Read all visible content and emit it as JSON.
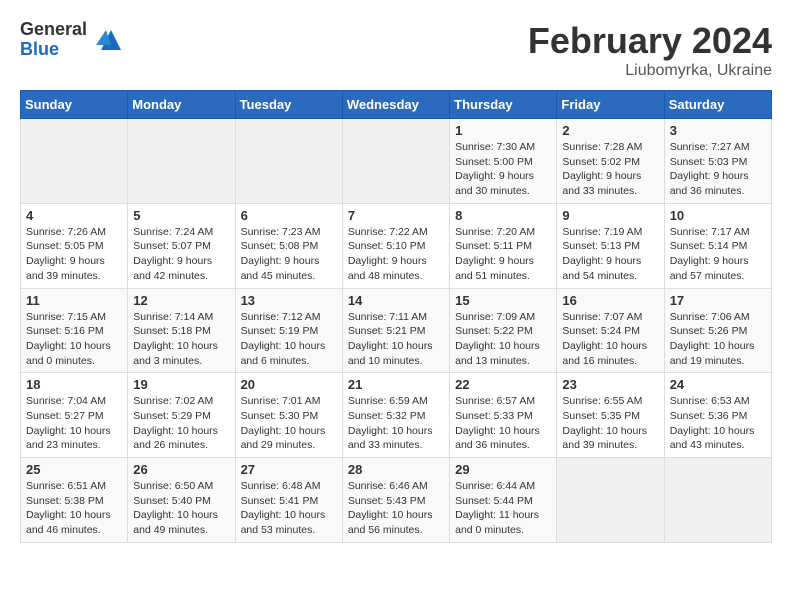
{
  "header": {
    "logo_general": "General",
    "logo_blue": "Blue",
    "month_title": "February 2024",
    "location": "Liubomyrka, Ukraine"
  },
  "weekdays": [
    "Sunday",
    "Monday",
    "Tuesday",
    "Wednesday",
    "Thursday",
    "Friday",
    "Saturday"
  ],
  "weeks": [
    [
      {
        "day": "",
        "info": ""
      },
      {
        "day": "",
        "info": ""
      },
      {
        "day": "",
        "info": ""
      },
      {
        "day": "",
        "info": ""
      },
      {
        "day": "1",
        "info": "Sunrise: 7:30 AM\nSunset: 5:00 PM\nDaylight: 9 hours\nand 30 minutes."
      },
      {
        "day": "2",
        "info": "Sunrise: 7:28 AM\nSunset: 5:02 PM\nDaylight: 9 hours\nand 33 minutes."
      },
      {
        "day": "3",
        "info": "Sunrise: 7:27 AM\nSunset: 5:03 PM\nDaylight: 9 hours\nand 36 minutes."
      }
    ],
    [
      {
        "day": "4",
        "info": "Sunrise: 7:26 AM\nSunset: 5:05 PM\nDaylight: 9 hours\nand 39 minutes."
      },
      {
        "day": "5",
        "info": "Sunrise: 7:24 AM\nSunset: 5:07 PM\nDaylight: 9 hours\nand 42 minutes."
      },
      {
        "day": "6",
        "info": "Sunrise: 7:23 AM\nSunset: 5:08 PM\nDaylight: 9 hours\nand 45 minutes."
      },
      {
        "day": "7",
        "info": "Sunrise: 7:22 AM\nSunset: 5:10 PM\nDaylight: 9 hours\nand 48 minutes."
      },
      {
        "day": "8",
        "info": "Sunrise: 7:20 AM\nSunset: 5:11 PM\nDaylight: 9 hours\nand 51 minutes."
      },
      {
        "day": "9",
        "info": "Sunrise: 7:19 AM\nSunset: 5:13 PM\nDaylight: 9 hours\nand 54 minutes."
      },
      {
        "day": "10",
        "info": "Sunrise: 7:17 AM\nSunset: 5:14 PM\nDaylight: 9 hours\nand 57 minutes."
      }
    ],
    [
      {
        "day": "11",
        "info": "Sunrise: 7:15 AM\nSunset: 5:16 PM\nDaylight: 10 hours\nand 0 minutes."
      },
      {
        "day": "12",
        "info": "Sunrise: 7:14 AM\nSunset: 5:18 PM\nDaylight: 10 hours\nand 3 minutes."
      },
      {
        "day": "13",
        "info": "Sunrise: 7:12 AM\nSunset: 5:19 PM\nDaylight: 10 hours\nand 6 minutes."
      },
      {
        "day": "14",
        "info": "Sunrise: 7:11 AM\nSunset: 5:21 PM\nDaylight: 10 hours\nand 10 minutes."
      },
      {
        "day": "15",
        "info": "Sunrise: 7:09 AM\nSunset: 5:22 PM\nDaylight: 10 hours\nand 13 minutes."
      },
      {
        "day": "16",
        "info": "Sunrise: 7:07 AM\nSunset: 5:24 PM\nDaylight: 10 hours\nand 16 minutes."
      },
      {
        "day": "17",
        "info": "Sunrise: 7:06 AM\nSunset: 5:26 PM\nDaylight: 10 hours\nand 19 minutes."
      }
    ],
    [
      {
        "day": "18",
        "info": "Sunrise: 7:04 AM\nSunset: 5:27 PM\nDaylight: 10 hours\nand 23 minutes."
      },
      {
        "day": "19",
        "info": "Sunrise: 7:02 AM\nSunset: 5:29 PM\nDaylight: 10 hours\nand 26 minutes."
      },
      {
        "day": "20",
        "info": "Sunrise: 7:01 AM\nSunset: 5:30 PM\nDaylight: 10 hours\nand 29 minutes."
      },
      {
        "day": "21",
        "info": "Sunrise: 6:59 AM\nSunset: 5:32 PM\nDaylight: 10 hours\nand 33 minutes."
      },
      {
        "day": "22",
        "info": "Sunrise: 6:57 AM\nSunset: 5:33 PM\nDaylight: 10 hours\nand 36 minutes."
      },
      {
        "day": "23",
        "info": "Sunrise: 6:55 AM\nSunset: 5:35 PM\nDaylight: 10 hours\nand 39 minutes."
      },
      {
        "day": "24",
        "info": "Sunrise: 6:53 AM\nSunset: 5:36 PM\nDaylight: 10 hours\nand 43 minutes."
      }
    ],
    [
      {
        "day": "25",
        "info": "Sunrise: 6:51 AM\nSunset: 5:38 PM\nDaylight: 10 hours\nand 46 minutes."
      },
      {
        "day": "26",
        "info": "Sunrise: 6:50 AM\nSunset: 5:40 PM\nDaylight: 10 hours\nand 49 minutes."
      },
      {
        "day": "27",
        "info": "Sunrise: 6:48 AM\nSunset: 5:41 PM\nDaylight: 10 hours\nand 53 minutes."
      },
      {
        "day": "28",
        "info": "Sunrise: 6:46 AM\nSunset: 5:43 PM\nDaylight: 10 hours\nand 56 minutes."
      },
      {
        "day": "29",
        "info": "Sunrise: 6:44 AM\nSunset: 5:44 PM\nDaylight: 11 hours\nand 0 minutes."
      },
      {
        "day": "",
        "info": ""
      },
      {
        "day": "",
        "info": ""
      }
    ]
  ]
}
